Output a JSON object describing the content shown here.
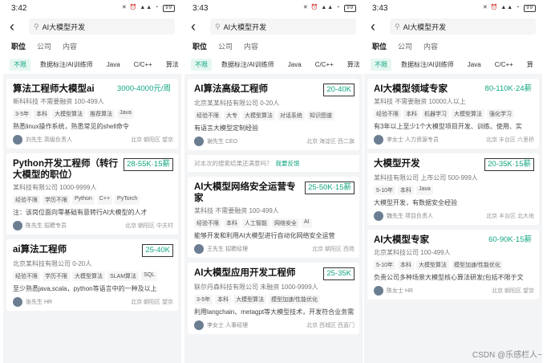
{
  "phones": [
    {
      "status": {
        "time": "3:42",
        "battery": "99"
      },
      "search": "AI大模型开发",
      "tabs": [
        "职位",
        "公司",
        "内容"
      ],
      "filters": [
        "不限",
        "数据标注/AI训练师",
        "Java",
        "C/C++",
        "算法"
      ],
      "jobs": [
        {
          "title": "算法工程师大模型ai",
          "salary": "3000-4000元/周",
          "boxed": false,
          "company": "新科科技  不需要融资  100-499人",
          "tags": [
            "3-5年",
            "本科",
            "大模型算法",
            "推荐算法",
            "Java"
          ],
          "desc": "熟悉linux操作系统，熟悉常见的shell命令",
          "recruiter": "刘先生  高级负责人",
          "location": "北京  朝阳区  望京"
        },
        {
          "title": "Python开发工程师（转行大模型的职位）",
          "salary": "28-55K·15薪",
          "boxed": true,
          "company": "某科技有限公司  1000-9999人",
          "tags": [
            "经验不限",
            "学历不限",
            "Python",
            "C++",
            "PyTorch"
          ],
          "desc": "注：该岗位面向零基础有意转行AI大模型的人才",
          "recruiter": "陈先生  招聘专员",
          "location": "北京  朝阳区  中关村"
        },
        {
          "title": "ai算法工程师",
          "salary": "25-40K",
          "boxed": true,
          "company": "北京某科技有限公司  0-20人",
          "tags": [
            "经验不限",
            "学历不限",
            "大模型算法",
            "SLAM算法",
            "SQL"
          ],
          "desc": "至少熟悉java,scala，python等语言中的一种及以上",
          "recruiter": "张先生  HR",
          "location": "北京  朝阳区  望京"
        }
      ]
    },
    {
      "status": {
        "time": "3:43",
        "battery": "99"
      },
      "search": "AI大模型开发",
      "tabs": [
        "职位",
        "公司",
        "内容"
      ],
      "filters": [
        "不限",
        "数据标注/AI训练师",
        "Java",
        "C/C++",
        "算法"
      ],
      "jobs": [
        {
          "title": "AI算法高级工程师",
          "salary": "20-40K",
          "boxed": true,
          "company": "北京某某科技有限公司  0-20人",
          "tags": [
            "经验不限",
            "大专",
            "大模型算法",
            "对话系统",
            "知识图谱"
          ],
          "desc": "有语言大模型定制经验",
          "recruiter": "谢先生  CEO",
          "location": "北京  海淀区  西二旗"
        }
      ],
      "feedback": {
        "text": "对本次的搜索结果还满意吗？",
        "link": "我要反馈"
      },
      "jobs_after": [
        {
          "title": "AI大模型网络安全运营专家",
          "salary": "25-50K·15薪",
          "boxed": true,
          "company": "某科技  不需要融资  100-499人",
          "tags": [
            "经验不限",
            "本科",
            "人工智能",
            "网络安全",
            "AI"
          ],
          "desc": "能够开发和利用AI大模型进行自动化网络安全运营",
          "recruiter": "王先生  招聘经理",
          "location": "北京  朝阳区  西苑"
        },
        {
          "title": "AI大模型应用开发工程师",
          "salary": "25-35K",
          "boxed": true,
          "company": "联尔丹森科技有限公司  未融资  1000-9999人",
          "tags": [
            "3-5年",
            "本科",
            "大模型算法",
            "模型加速/性能优化"
          ],
          "desc": "利用langchain、metagpt等大模型技术，开发符合业务需求",
          "recruiter": "李女士  人事经理",
          "location": "北京  西城区  西直门"
        }
      ]
    },
    {
      "status": {
        "time": "3:43",
        "battery": "99"
      },
      "search": "AI大模型开发",
      "tabs": [
        "职位",
        "公司",
        "内容"
      ],
      "filters": [
        "不限",
        "数据标注/AI训练师",
        "Java",
        "C/C++",
        "算"
      ],
      "jobs": [
        {
          "title": "AI大模型领域专家",
          "salary": "80-110K·24薪",
          "boxed": false,
          "company": "某科技  不需要融资  10000人以上",
          "tags": [
            "经验不限",
            "本科",
            "机器学习",
            "大模型算法",
            "强化学习"
          ],
          "desc": "有3年以上至少1个大模型项目开发、训练、使用、实",
          "recruiter": "李女士  人力资源专员",
          "location": "北京  丰台区  六里桥"
        },
        {
          "title": "大模型开发",
          "salary": "20-35K·15薪",
          "boxed": true,
          "company": "某科技有限公司  上市公司  500-999人",
          "tags": [
            "5-10年",
            "本科",
            "Java"
          ],
          "desc": "大模型开发，有数据安全经验",
          "recruiter": "魏先生  项目负责人",
          "location": "北京  丰台区  北大地"
        },
        {
          "title": "AI大模型专家",
          "salary": "60-90K·15薪",
          "boxed": false,
          "company": "北京某科技公司  100-499人",
          "tags": [
            "5-10年",
            "本科",
            "大模型算法",
            "模型加速/性能优化"
          ],
          "desc": "负责公司多种场景大模型核心算法研发(包括不限于文",
          "recruiter": "陈女士  HR",
          "location": "北京  朝阳区  望京"
        }
      ]
    }
  ],
  "watermark": "CSDN @乐感栏人~",
  "colors": {
    "accent": "#12a682",
    "page_bg": "#f3f4f6"
  },
  "icons": {
    "back": "back-arrow-icon",
    "search": "search-icon",
    "avatar": "avatar-icon"
  }
}
